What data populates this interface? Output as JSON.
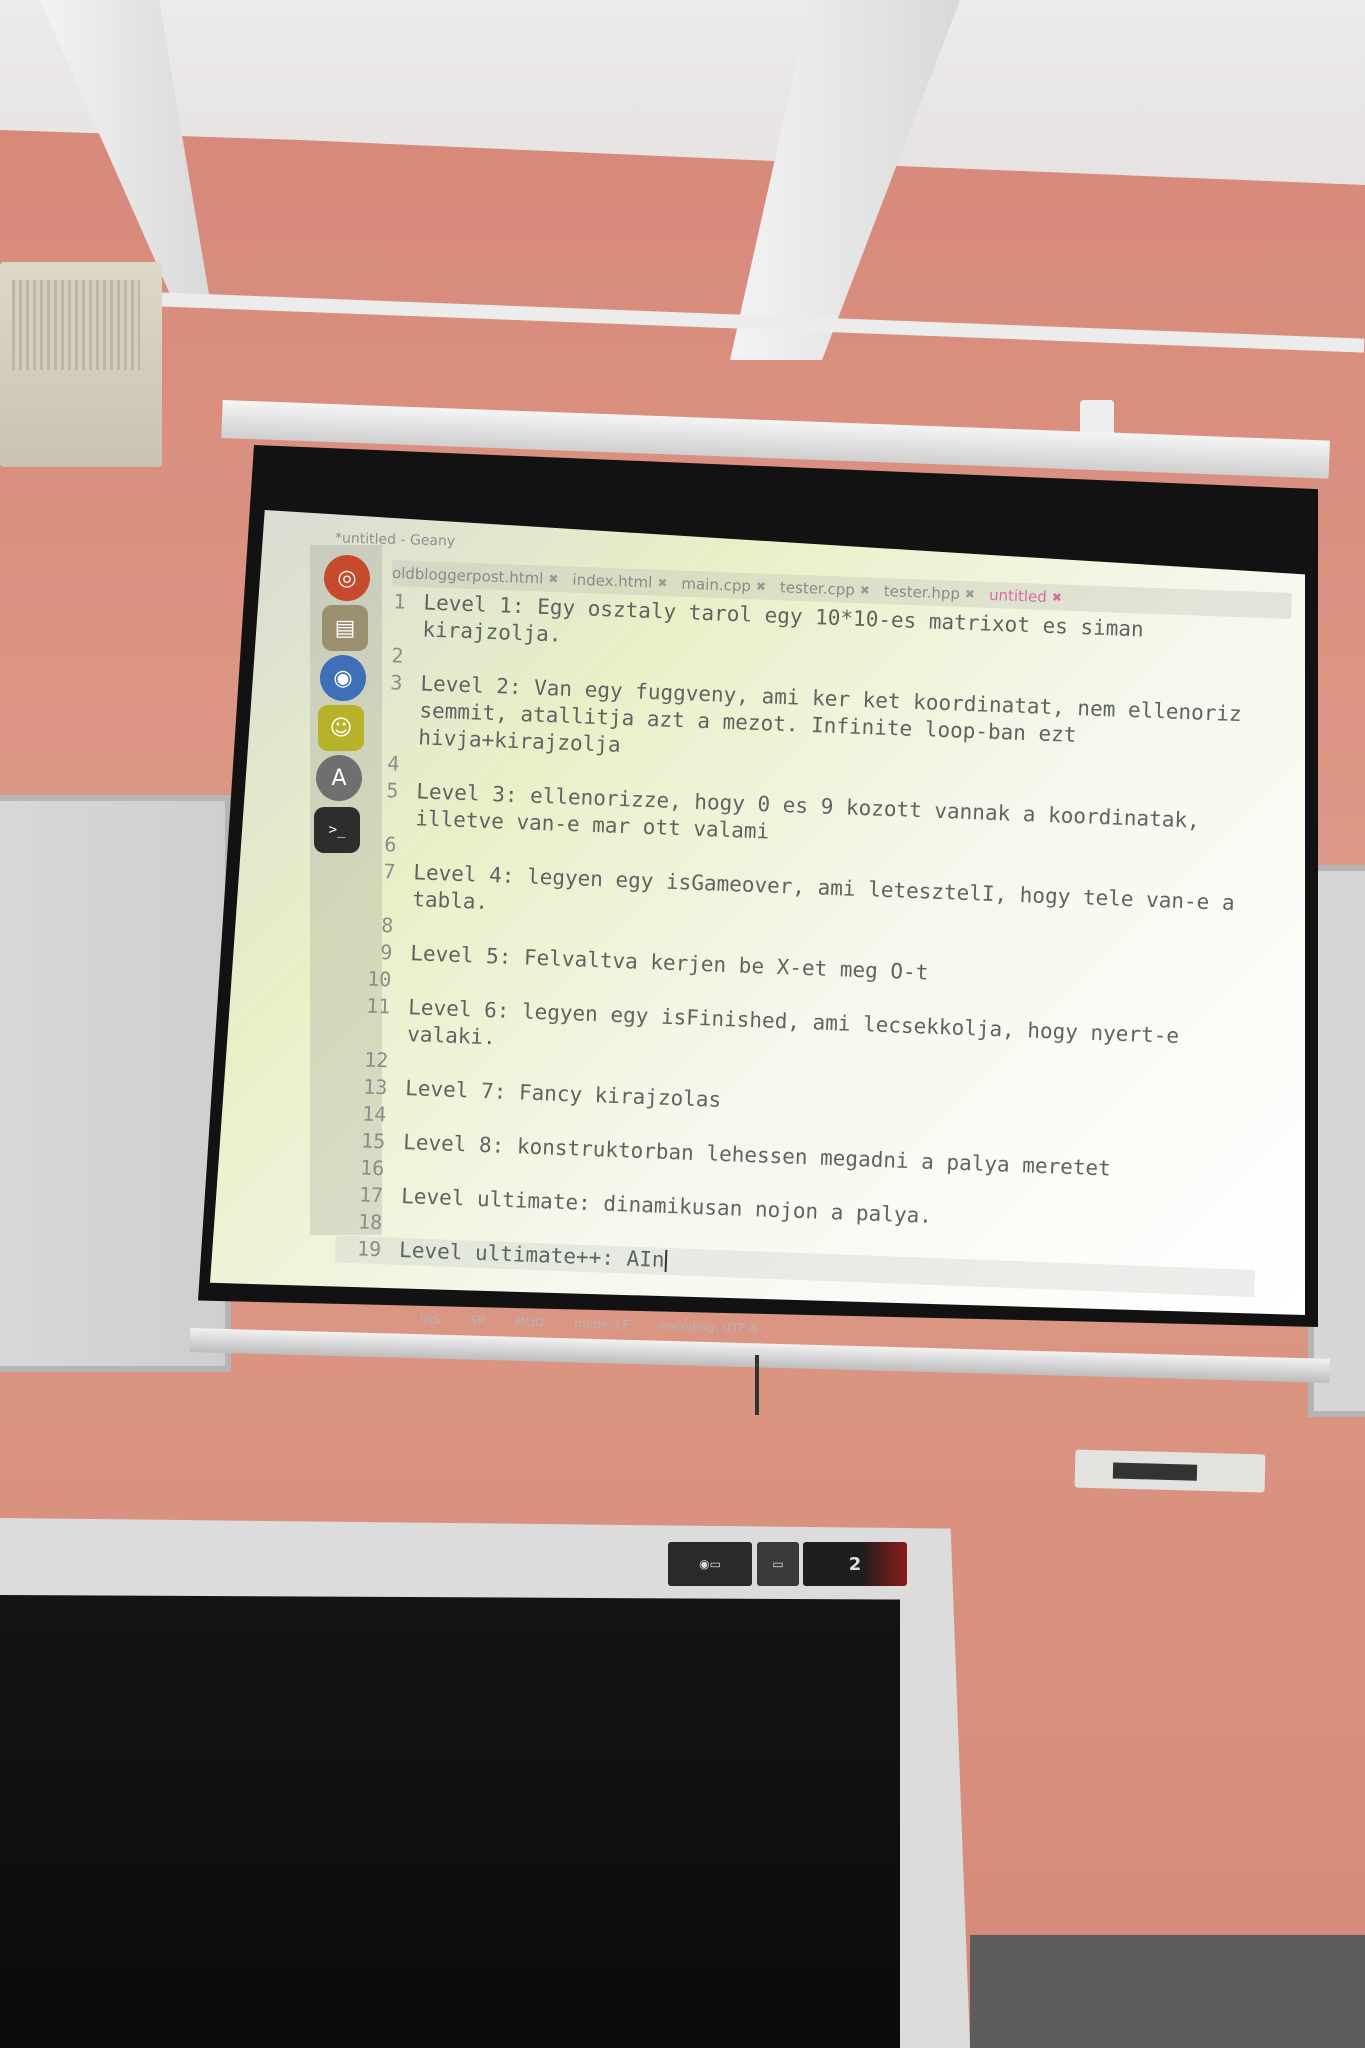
{
  "window": {
    "title": "*untitled - Geany"
  },
  "launcher": {
    "icons": [
      "ubuntu-icon",
      "files-icon",
      "browser-icon",
      "chat-icon",
      "software-center-icon",
      "terminal-icon"
    ]
  },
  "tabs": [
    {
      "label": "oldbloggerpost.html",
      "close": "✖",
      "active": false
    },
    {
      "label": "index.html",
      "close": "✖",
      "active": false
    },
    {
      "label": "main.cpp",
      "close": "✖",
      "active": false
    },
    {
      "label": "tester.cpp",
      "close": "✖",
      "active": false
    },
    {
      "label": "tester.hpp",
      "close": "✖",
      "active": false
    },
    {
      "label": "untitled",
      "close": "✖",
      "active": true
    }
  ],
  "editor": {
    "lines": [
      {
        "n": "1",
        "text": "Level 1: Egy osztaly tarol egy 10*10-es matrixot es siman"
      },
      {
        "n": "",
        "text": "kirajzolja."
      },
      {
        "n": "2",
        "text": ""
      },
      {
        "n": "3",
        "text": "Level 2: Van egy fuggveny, ami ker ket koordinatat, nem ellenoriz"
      },
      {
        "n": "",
        "text": "semmit, atallitja azt a mezot. Infinite loop-ban ezt"
      },
      {
        "n": "",
        "text": "hivja+kirajzolja"
      },
      {
        "n": "4",
        "text": ""
      },
      {
        "n": "5",
        "text": "Level 3: ellenorizze, hogy 0 es 9 kozott vannak a koordinatak,"
      },
      {
        "n": "",
        "text": "illetve van-e mar ott valami"
      },
      {
        "n": "6",
        "text": ""
      },
      {
        "n": "7",
        "text": "Level 4: legyen egy isGameover, ami letesztelI, hogy tele van-e a"
      },
      {
        "n": "",
        "text": "tabla."
      },
      {
        "n": "8",
        "text": ""
      },
      {
        "n": "9",
        "text": "Level 5: Felvaltva kerjen be X-et meg O-t"
      },
      {
        "n": "10",
        "text": ""
      },
      {
        "n": "11",
        "text": "Level 6: legyen egy isFinished, ami lecsekkolja, hogy nyert-e"
      },
      {
        "n": "",
        "text": "valaki."
      },
      {
        "n": "12",
        "text": ""
      },
      {
        "n": "13",
        "text": "Level 7: Fancy kirajzolas"
      },
      {
        "n": "14",
        "text": ""
      },
      {
        "n": "15",
        "text": "Level 8: konstruktorban lehessen megadni a palya meretet"
      },
      {
        "n": "16",
        "text": ""
      },
      {
        "n": "17",
        "text": "Level ultimate: dinamikusan nojon a palya."
      },
      {
        "n": "18",
        "text": ""
      },
      {
        "n": "19",
        "text": "Level ultimate++: AIn"
      }
    ]
  },
  "statusbar": {
    "items": [
      "INS",
      "SP",
      "MOD",
      "mode: LF",
      "encoding: UTF-8"
    ]
  },
  "monitor": {
    "brand_sticker": "2"
  },
  "colors": {
    "wall": "#d9917e",
    "projection": "#eef3dc",
    "active_tab": "#d86aa4",
    "code_text": "#5e6460"
  }
}
